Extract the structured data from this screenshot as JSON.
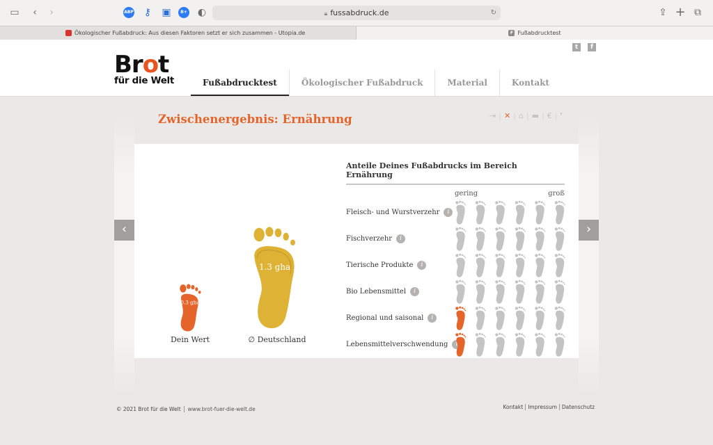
{
  "browser": {
    "url": "fussabdruck.de",
    "tabs": [
      {
        "title": "Ökologischer Fußabdruck: Aus diesen Faktoren setzt er sich zusammen - Utopia.de",
        "favicon": "utopia-favicon"
      },
      {
        "title": "Fußabdrucktest",
        "favicon": "F"
      }
    ],
    "extensions": [
      "ABP",
      "B+"
    ]
  },
  "site": {
    "logo_main_a": "Br",
    "logo_main_o": "o",
    "logo_main_b": "t",
    "logo_sub": "für die Welt",
    "nav": [
      "Fußabdrucktest",
      "Ökologischer Fußabdruck",
      "Material",
      "Kontakt"
    ],
    "social": [
      "t",
      "f"
    ]
  },
  "content": {
    "title": "Zwischenergebnis: Ernährung",
    "your_value_label": "Dein Wert",
    "your_value": "0.3 gha",
    "avg_label": "∅ Deutschland",
    "avg_value": "1.3 gha",
    "breakdown": {
      "title": "Anteile Deines Fußabdrucks im Bereich Ernährung",
      "scale_low": "gering",
      "scale_high": "groß",
      "rows": [
        {
          "label": "Fleisch- und Wurstverzehr",
          "level": 0
        },
        {
          "label": "Fischverzehr",
          "level": 0
        },
        {
          "label": "Tierische Produkte",
          "level": 0
        },
        {
          "label": "Bio Lebensmittel",
          "level": 0
        },
        {
          "label": "Regional und saisonal",
          "level": 1
        },
        {
          "label": "Lebensmittelverschwendung",
          "level": 1
        }
      ]
    },
    "step_icons": [
      "exit-icon",
      "food-icon",
      "house-icon",
      "car-icon",
      "euro-icon",
      "foot-icon"
    ]
  },
  "footer": {
    "copyright": "© 2021 Brot für die Welt",
    "url": "www.brot-fuer-die-welt.de",
    "links": [
      "Kontakt",
      "Impressum",
      "Datenschutz"
    ]
  },
  "colors": {
    "accent": "#e4642a",
    "avg_foot": "#deb335",
    "inactive_foot": "#c4c4c4"
  }
}
